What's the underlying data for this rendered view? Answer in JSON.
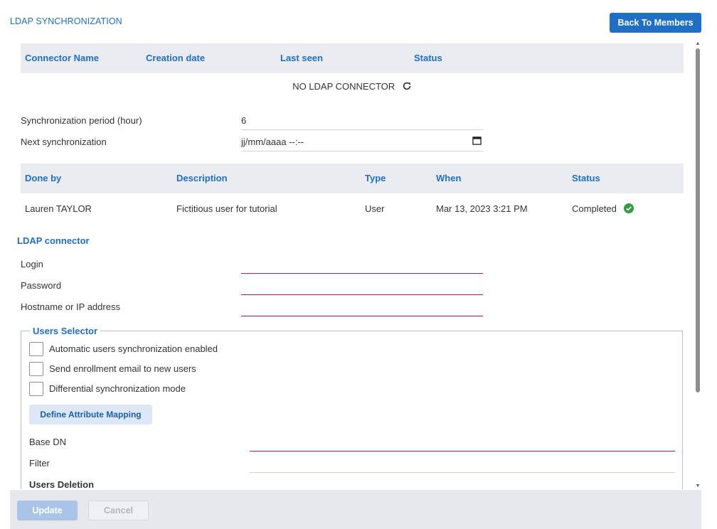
{
  "header": {
    "title": "LDAP SYNCHRONIZATION",
    "back_label": "Back To Members"
  },
  "connectors_table": {
    "columns": [
      "Connector Name",
      "Creation date",
      "Last seen",
      "Status"
    ],
    "empty_text": "NO LDAP CONNECTOR"
  },
  "sync": {
    "period_label": "Synchronization period (hour)",
    "period_value": "6",
    "next_label": "Next synchronization",
    "next_value": "jj/mm/aaaa --:--"
  },
  "history_table": {
    "columns": [
      "Done by",
      "Description",
      "Type",
      "When",
      "Status"
    ],
    "rows": [
      {
        "done_by": "Lauren TAYLOR",
        "description": "Fictitious user for tutorial",
        "type": "User",
        "when": "Mar 13, 2023 3:21 PM",
        "status": "Completed"
      }
    ]
  },
  "connector": {
    "title": "LDAP connector",
    "login_label": "Login",
    "password_label": "Password",
    "host_label": "Hostname or IP address"
  },
  "users_selector": {
    "legend": "Users Selector",
    "checkboxes": [
      {
        "label": "Automatic users synchronization enabled",
        "checked": false
      },
      {
        "label": "Send enrollment email to new users",
        "checked": false
      },
      {
        "label": "Differential synchronization mode",
        "checked": false
      }
    ],
    "mapping_button": "Define Attribute Mapping",
    "base_dn_label": "Base DN",
    "filter_label": "Filter",
    "deletion_label": "Users Deletion"
  },
  "footer": {
    "update_label": "Update",
    "cancel_label": "Cancel"
  },
  "colors": {
    "accent": "#1f6fc5",
    "required_underline": "#b1174b",
    "success": "#2e9e3e",
    "table_header_bg": "#e9ebf0"
  },
  "icons": [
    "refresh-icon",
    "calendar-icon",
    "check-circle-icon"
  ]
}
